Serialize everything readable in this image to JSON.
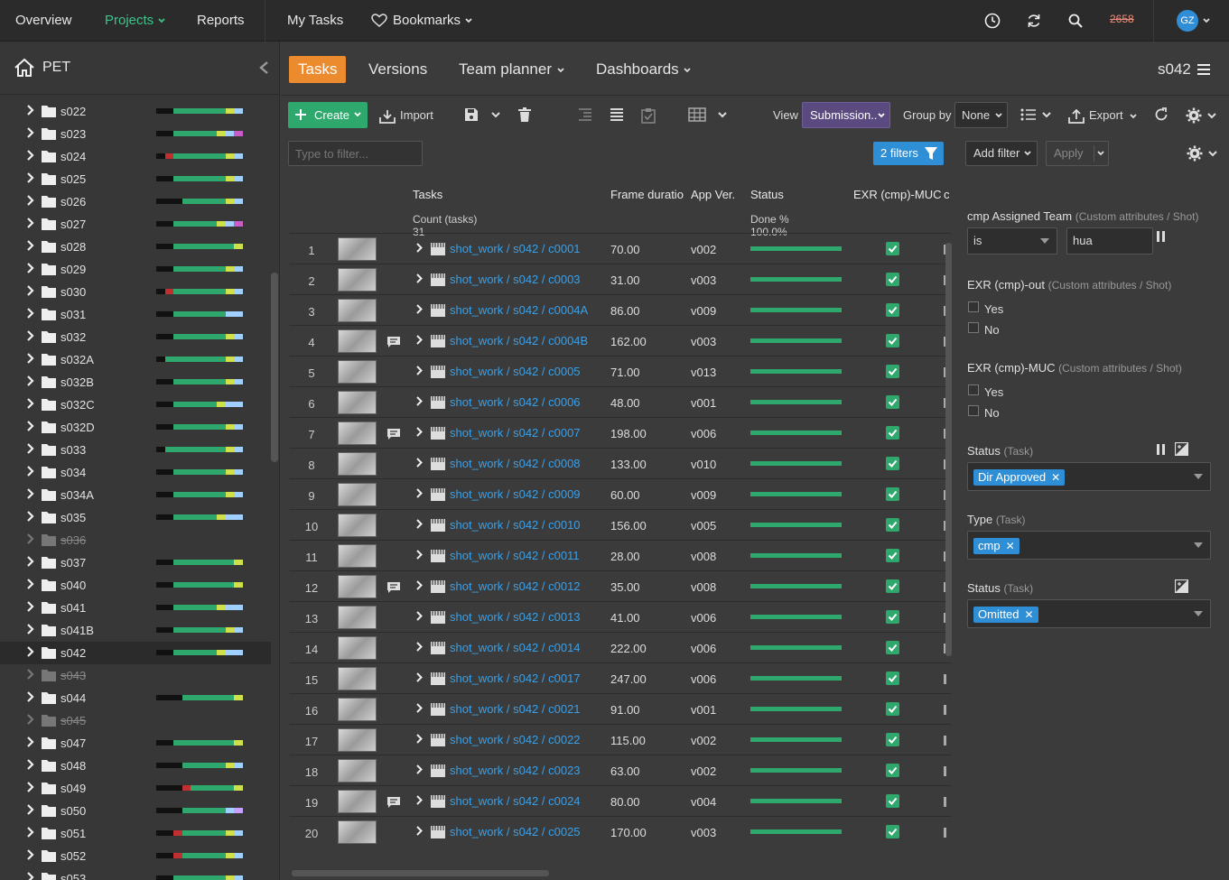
{
  "nav": {
    "overview": "Overview",
    "projects": "Projects",
    "reports": "Reports",
    "my_tasks": "My Tasks",
    "bookmarks": "Bookmarks",
    "badge": "2658",
    "avatar": "GZ",
    "accent": "#3ec48b"
  },
  "sidebar": {
    "project": "PET",
    "items": [
      {
        "label": "s022",
        "omitted": false,
        "bar": [
          "#111",
          "#111",
          "#2fa86e",
          "#2fa86e",
          "#2fa86e",
          "#2fa86e",
          "#2fa86e",
          "#2fa86e",
          "#cfe04a",
          "#9fd0ff"
        ]
      },
      {
        "label": "s023",
        "omitted": false,
        "bar": [
          "#111",
          "#111",
          "#2fa86e",
          "#2fa86e",
          "#2fa86e",
          "#2fa86e",
          "#2fa86e",
          "#cfe04a",
          "#9fd0ff",
          "#c85cc8"
        ]
      },
      {
        "label": "s024",
        "omitted": false,
        "bar": [
          "#111",
          "#c03030",
          "#2fa86e",
          "#2fa86e",
          "#2fa86e",
          "#2fa86e",
          "#2fa86e",
          "#2fa86e",
          "#cfe04a",
          "#9fd0ff"
        ]
      },
      {
        "label": "s025",
        "omitted": false,
        "bar": [
          "#111",
          "#111",
          "#2fa86e",
          "#2fa86e",
          "#2fa86e",
          "#2fa86e",
          "#2fa86e",
          "#2fa86e",
          "#cfe04a",
          "#9fd0ff"
        ]
      },
      {
        "label": "s026",
        "omitted": false,
        "bar": [
          "#111",
          "#111",
          "#111",
          "#2fa86e",
          "#2fa86e",
          "#2fa86e",
          "#2fa86e",
          "#2fa86e",
          "#cfe04a",
          "#9fd0ff"
        ]
      },
      {
        "label": "s027",
        "omitted": false,
        "bar": [
          "#111",
          "#111",
          "#2fa86e",
          "#2fa86e",
          "#2fa86e",
          "#2fa86e",
          "#2fa86e",
          "#cfe04a",
          "#9fd0ff",
          "#c85cc8"
        ]
      },
      {
        "label": "s028",
        "omitted": false,
        "bar": [
          "#111",
          "#111",
          "#2fa86e",
          "#2fa86e",
          "#2fa86e",
          "#2fa86e",
          "#2fa86e",
          "#2fa86e",
          "#2fa86e",
          "#cfe04a"
        ]
      },
      {
        "label": "s029",
        "omitted": false,
        "bar": [
          "#111",
          "#111",
          "#2fa86e",
          "#2fa86e",
          "#2fa86e",
          "#2fa86e",
          "#2fa86e",
          "#2fa86e",
          "#cfe04a",
          "#9fd0ff"
        ]
      },
      {
        "label": "s030",
        "omitted": false,
        "bar": [
          "#111",
          "#c03030",
          "#2fa86e",
          "#2fa86e",
          "#2fa86e",
          "#2fa86e",
          "#2fa86e",
          "#2fa86e",
          "#cfe04a",
          "#9fd0ff"
        ]
      },
      {
        "label": "s031",
        "omitted": false,
        "bar": [
          "#111",
          "#111",
          "#2fa86e",
          "#2fa86e",
          "#2fa86e",
          "#2fa86e",
          "#2fa86e",
          "#2fa86e",
          "#9fd0ff",
          "#9fd0ff"
        ]
      },
      {
        "label": "s032",
        "omitted": false,
        "bar": [
          "#111",
          "#111",
          "#2fa86e",
          "#2fa86e",
          "#2fa86e",
          "#2fa86e",
          "#2fa86e",
          "#2fa86e",
          "#cfe04a",
          "#9fd0ff"
        ]
      },
      {
        "label": "s032A",
        "omitted": false,
        "bar": [
          "#111",
          "#2fa86e",
          "#2fa86e",
          "#2fa86e",
          "#2fa86e",
          "#2fa86e",
          "#2fa86e",
          "#2fa86e",
          "#cfe04a",
          "#9fd0ff"
        ]
      },
      {
        "label": "s032B",
        "omitted": false,
        "bar": [
          "#111",
          "#111",
          "#2fa86e",
          "#2fa86e",
          "#2fa86e",
          "#2fa86e",
          "#2fa86e",
          "#2fa86e",
          "#cfe04a",
          "#9fd0ff"
        ]
      },
      {
        "label": "s032C",
        "omitted": false,
        "bar": [
          "#111",
          "#111",
          "#2fa86e",
          "#2fa86e",
          "#2fa86e",
          "#2fa86e",
          "#2fa86e",
          "#cfe04a",
          "#9fd0ff",
          "#9fd0ff"
        ]
      },
      {
        "label": "s032D",
        "omitted": false,
        "bar": [
          "#111",
          "#111",
          "#2fa86e",
          "#2fa86e",
          "#2fa86e",
          "#2fa86e",
          "#2fa86e",
          "#2fa86e",
          "#cfe04a",
          "#9fd0ff"
        ]
      },
      {
        "label": "s033",
        "omitted": false,
        "bar": [
          "#111",
          "#2fa86e",
          "#2fa86e",
          "#2fa86e",
          "#2fa86e",
          "#2fa86e",
          "#2fa86e",
          "#2fa86e",
          "#cfe04a",
          "#9fd0ff"
        ]
      },
      {
        "label": "s034",
        "omitted": false,
        "bar": [
          "#111",
          "#111",
          "#2fa86e",
          "#2fa86e",
          "#2fa86e",
          "#2fa86e",
          "#2fa86e",
          "#2fa86e",
          "#cfe04a",
          "#9fd0ff"
        ]
      },
      {
        "label": "s034A",
        "omitted": false,
        "bar": [
          "#111",
          "#111",
          "#2fa86e",
          "#2fa86e",
          "#2fa86e",
          "#2fa86e",
          "#2fa86e",
          "#2fa86e",
          "#cfe04a",
          "#9fd0ff"
        ]
      },
      {
        "label": "s035",
        "omitted": false,
        "bar": [
          "#111",
          "#111",
          "#2fa86e",
          "#2fa86e",
          "#2fa86e",
          "#2fa86e",
          "#2fa86e",
          "#cfe04a",
          "#9fd0ff",
          "#9fd0ff"
        ]
      },
      {
        "label": "s036",
        "omitted": true,
        "bar": []
      },
      {
        "label": "s037",
        "omitted": false,
        "bar": [
          "#111",
          "#111",
          "#2fa86e",
          "#2fa86e",
          "#2fa86e",
          "#2fa86e",
          "#2fa86e",
          "#2fa86e",
          "#2fa86e",
          "#cfe04a"
        ]
      },
      {
        "label": "s040",
        "omitted": false,
        "bar": [
          "#111",
          "#111",
          "#2fa86e",
          "#2fa86e",
          "#2fa86e",
          "#2fa86e",
          "#2fa86e",
          "#2fa86e",
          "#2fa86e",
          "#cfe04a"
        ]
      },
      {
        "label": "s041",
        "omitted": false,
        "bar": [
          "#111",
          "#111",
          "#2fa86e",
          "#2fa86e",
          "#2fa86e",
          "#2fa86e",
          "#2fa86e",
          "#cfe04a",
          "#9fd0ff",
          "#9fd0ff"
        ]
      },
      {
        "label": "s041B",
        "omitted": false,
        "bar": [
          "#111",
          "#111",
          "#2fa86e",
          "#2fa86e",
          "#2fa86e",
          "#2fa86e",
          "#2fa86e",
          "#2fa86e",
          "#cfe04a",
          "#9fd0ff"
        ]
      },
      {
        "label": "s042",
        "omitted": false,
        "selected": true,
        "bar": [
          "#111",
          "#111",
          "#2fa86e",
          "#2fa86e",
          "#2fa86e",
          "#2fa86e",
          "#2fa86e",
          "#cfe04a",
          "#9fd0ff",
          "#9fd0ff"
        ]
      },
      {
        "label": "s043",
        "omitted": true,
        "bar": []
      },
      {
        "label": "s044",
        "omitted": false,
        "bar": [
          "#111",
          "#111",
          "#111",
          "#2fa86e",
          "#2fa86e",
          "#2fa86e",
          "#2fa86e",
          "#2fa86e",
          "#2fa86e",
          "#cfe04a"
        ]
      },
      {
        "label": "s045",
        "omitted": true,
        "bar": []
      },
      {
        "label": "s047",
        "omitted": false,
        "bar": [
          "#111",
          "#111",
          "#2fa86e",
          "#2fa86e",
          "#2fa86e",
          "#2fa86e",
          "#2fa86e",
          "#2fa86e",
          "#2fa86e",
          "#cfe04a"
        ]
      },
      {
        "label": "s048",
        "omitted": false,
        "bar": [
          "#111",
          "#111",
          "#111",
          "#2fa86e",
          "#2fa86e",
          "#2fa86e",
          "#2fa86e",
          "#2fa86e",
          "#cfe04a",
          "#9fd0ff"
        ]
      },
      {
        "label": "s049",
        "omitted": false,
        "bar": [
          "#111",
          "#111",
          "#111",
          "#c03030",
          "#2fa86e",
          "#2fa86e",
          "#2fa86e",
          "#2fa86e",
          "#2fa86e",
          "#cfe04a"
        ]
      },
      {
        "label": "s050",
        "omitted": false,
        "bar": [
          "#111",
          "#111",
          "#111",
          "#2fa86e",
          "#2fa86e",
          "#2fa86e",
          "#2fa86e",
          "#2fa86e",
          "#9fd0ff",
          "#c8a0ff"
        ]
      },
      {
        "label": "s051",
        "omitted": false,
        "bar": [
          "#111",
          "#111",
          "#c03030",
          "#2fa86e",
          "#2fa86e",
          "#2fa86e",
          "#2fa86e",
          "#2fa86e",
          "#cfe04a",
          "#9fd0ff"
        ]
      },
      {
        "label": "s052",
        "omitted": false,
        "bar": [
          "#111",
          "#111",
          "#c03030",
          "#2fa86e",
          "#2fa86e",
          "#2fa86e",
          "#2fa86e",
          "#2fa86e",
          "#cfe04a",
          "#9fd0ff"
        ]
      },
      {
        "label": "s053",
        "omitted": false,
        "bar": [
          "#111",
          "#111",
          "#2fa86e",
          "#2fa86e",
          "#2fa86e",
          "#2fa86e",
          "#2fa86e",
          "#2fa86e",
          "#cfe04a",
          "#9fd0ff"
        ]
      }
    ]
  },
  "tabs": {
    "tasks": "Tasks",
    "versions": "Versions",
    "team_planner": "Team planner",
    "dashboards": "Dashboards",
    "current": "s042"
  },
  "toolbar": {
    "create": "Create",
    "import": "Import",
    "view_label": "View",
    "view_value": "Submission..",
    "group_label": "Group by",
    "group_value": "None",
    "export": "Export",
    "filter_placeholder": "Type to filter...",
    "filters_count": "2 filters"
  },
  "table": {
    "headers": {
      "tasks": "Tasks",
      "frame": "Frame duratio",
      "appver": "App Ver.",
      "status": "Status",
      "exr": "EXR (cmp)-MUC",
      "cut": "c"
    },
    "summary": {
      "count_label": "Count (tasks)",
      "count_value": "31",
      "done_label": "Done %",
      "done_value": "100.0%"
    },
    "rows": [
      {
        "n": "1",
        "name": "shot_work / s042 / c0001",
        "fd": "70.00",
        "av": "v002",
        "note": false,
        "done": 1.0
      },
      {
        "n": "2",
        "name": "shot_work / s042 / c0003",
        "fd": "31.00",
        "av": "v003",
        "note": false,
        "done": 1.0
      },
      {
        "n": "3",
        "name": "shot_work / s042 / c0004A",
        "fd": "86.00",
        "av": "v009",
        "note": false,
        "done": 1.0
      },
      {
        "n": "4",
        "name": "shot_work / s042 / c0004B",
        "fd": "162.00",
        "av": "v003",
        "note": true,
        "done": 1.0
      },
      {
        "n": "5",
        "name": "shot_work / s042 / c0005",
        "fd": "71.00",
        "av": "v013",
        "note": false,
        "done": 1.0
      },
      {
        "n": "6",
        "name": "shot_work / s042 / c0006",
        "fd": "48.00",
        "av": "v001",
        "note": false,
        "done": 1.0
      },
      {
        "n": "7",
        "name": "shot_work / s042 / c0007",
        "fd": "198.00",
        "av": "v006",
        "note": true,
        "done": 1.0
      },
      {
        "n": "8",
        "name": "shot_work / s042 / c0008",
        "fd": "133.00",
        "av": "v010",
        "note": false,
        "done": 1.0
      },
      {
        "n": "9",
        "name": "shot_work / s042 / c0009",
        "fd": "60.00",
        "av": "v009",
        "note": false,
        "done": 1.0
      },
      {
        "n": "10",
        "name": "shot_work / s042 / c0010",
        "fd": "156.00",
        "av": "v005",
        "note": false,
        "done": 1.0
      },
      {
        "n": "11",
        "name": "shot_work / s042 / c0011",
        "fd": "28.00",
        "av": "v008",
        "note": false,
        "done": 1.0
      },
      {
        "n": "12",
        "name": "shot_work / s042 / c0012",
        "fd": "35.00",
        "av": "v008",
        "note": true,
        "done": 1.0
      },
      {
        "n": "13",
        "name": "shot_work / s042 / c0013",
        "fd": "41.00",
        "av": "v006",
        "note": false,
        "done": 1.0
      },
      {
        "n": "14",
        "name": "shot_work / s042 / c0014",
        "fd": "222.00",
        "av": "v006",
        "note": false,
        "done": 1.0
      },
      {
        "n": "15",
        "name": "shot_work / s042 / c0017",
        "fd": "247.00",
        "av": "v006",
        "note": false,
        "done": 1.0
      },
      {
        "n": "16",
        "name": "shot_work / s042 / c0021",
        "fd": "91.00",
        "av": "v001",
        "note": false,
        "done": 1.0
      },
      {
        "n": "17",
        "name": "shot_work / s042 / c0022",
        "fd": "115.00",
        "av": "v002",
        "note": false,
        "done": 1.0
      },
      {
        "n": "18",
        "name": "shot_work / s042 / c0023",
        "fd": "63.00",
        "av": "v002",
        "note": false,
        "done": 1.0
      },
      {
        "n": "19",
        "name": "shot_work / s042 / c0024",
        "fd": "80.00",
        "av": "v004",
        "note": true,
        "done": 1.0
      },
      {
        "n": "20",
        "name": "shot_work / s042 / c0025",
        "fd": "170.00",
        "av": "v003",
        "note": false,
        "done": 1.0
      }
    ]
  },
  "filters": {
    "add_filter": "Add filter",
    "apply": "Apply",
    "f1_title": "cmp Assigned Team",
    "f1_sub": "(Custom attributes / Shot)",
    "f1_op": "is",
    "f1_value": "hua",
    "f2_title": "EXR (cmp)-out",
    "f2_sub": "(Custom attributes / Shot)",
    "f2_yes": "Yes",
    "f2_no": "No",
    "f3_title": "EXR (cmp)-MUC",
    "f3_sub": "(Custom attributes / Shot)",
    "f3_yes": "Yes",
    "f3_no": "No",
    "f4_title": "Status",
    "f4_sub": "(Task)",
    "f4_tag": "Dir Approved",
    "f5_title": "Type",
    "f5_sub": "(Task)",
    "f5_tag": "cmp",
    "f6_title": "Status",
    "f6_sub": "(Task)",
    "f6_tag": "Omitted"
  }
}
